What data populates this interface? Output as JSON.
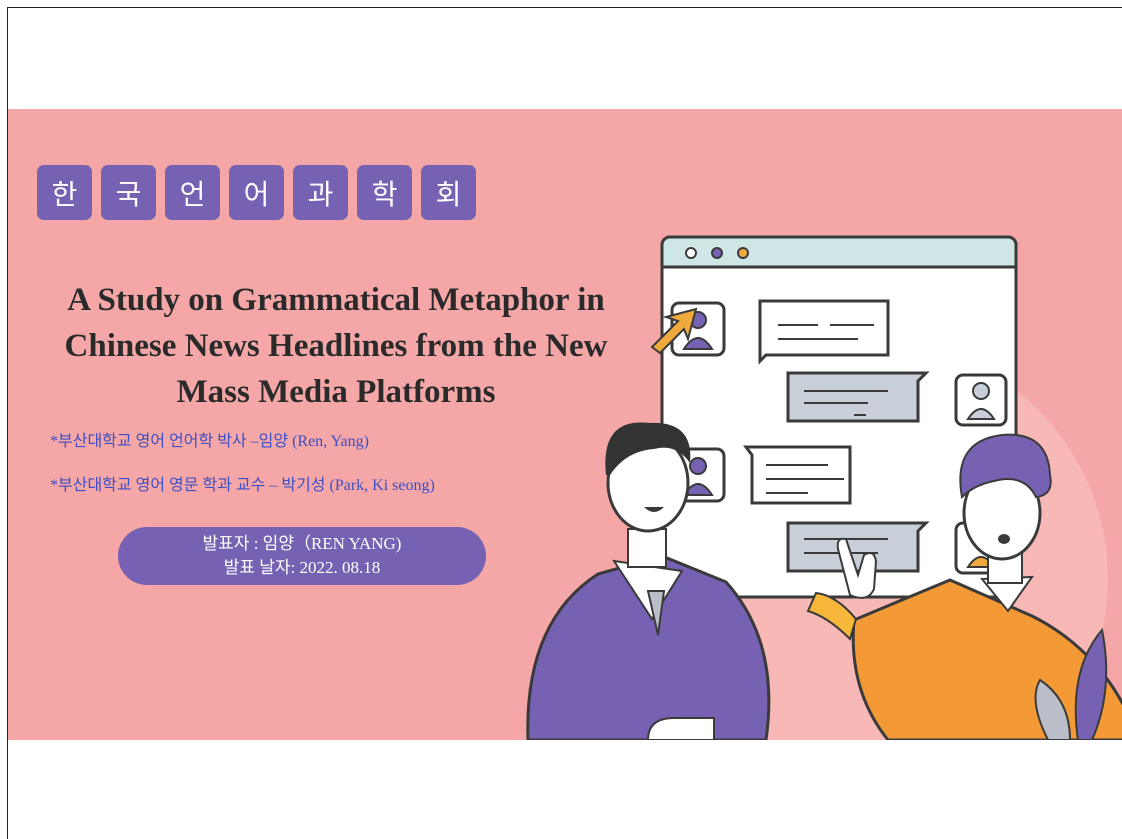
{
  "slide": {
    "org_tiles": [
      "한",
      "국",
      "언",
      "어",
      "과",
      "학",
      "회"
    ],
    "title_lines": [
      "A Study on Grammatical Metaphor in",
      "Chinese News Headlines from the New",
      "Mass Media Platforms"
    ],
    "authors": [
      "*부산대학교 영어 언어학 박사 –임양  (Ren, Yang)",
      "*부산대학교 영어 영문 학과 교수 – 박기성 (Park, Ki seong)"
    ],
    "presenter": {
      "line1": "발표자 : 임양（REN YANG)",
      "line2": "발표 날자:  2022. 08.18"
    }
  },
  "colors": {
    "background": "#f4a7a6",
    "accent_purple": "#7661b3",
    "author_blue": "#3b4fc7",
    "title": "#2a2a2a"
  },
  "illustration": {
    "icons": [
      "chat-window-icon",
      "user-avatar-icon",
      "message-bubble-icon",
      "cursor-arrow-icon",
      "man-purple-sweater-icon",
      "man-orange-sweater-icon",
      "plant-leaf-icon"
    ]
  }
}
